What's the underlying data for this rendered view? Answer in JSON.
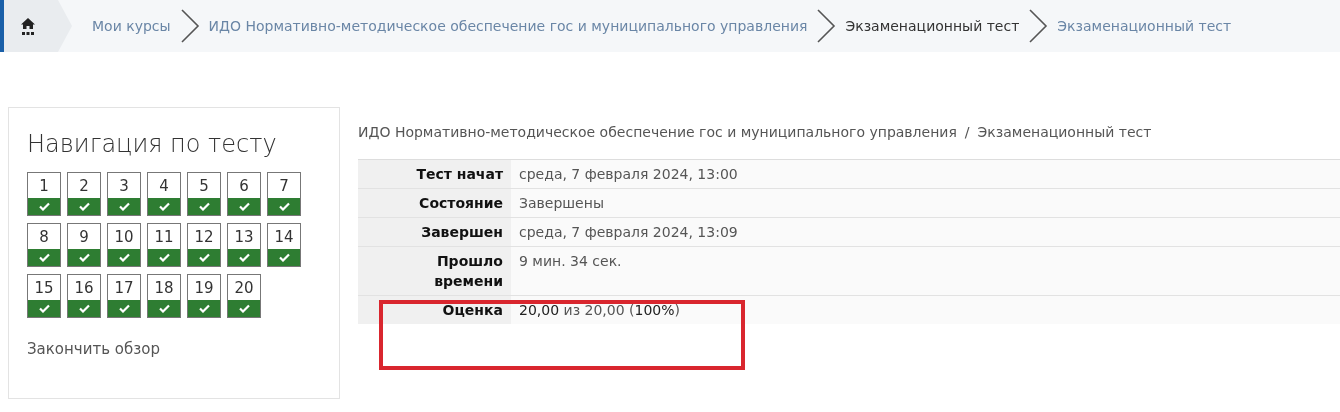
{
  "breadcrumb": [
    {
      "label": "Мои курсы",
      "kind": "link"
    },
    {
      "label": "ИДО Нормативно-методическое обеспечение гос и муниципального управления",
      "kind": "link"
    },
    {
      "label": "Экзаменационный тест",
      "kind": "current"
    },
    {
      "label": "Экзаменационный тест",
      "kind": "link"
    }
  ],
  "quiz_navigation": {
    "title": "Навигация по тесту",
    "questions": [
      {
        "number": "1",
        "answered": true
      },
      {
        "number": "2",
        "answered": true
      },
      {
        "number": "3",
        "answered": true
      },
      {
        "number": "4",
        "answered": true
      },
      {
        "number": "5",
        "answered": true
      },
      {
        "number": "6",
        "answered": true
      },
      {
        "number": "7",
        "answered": true
      },
      {
        "number": "8",
        "answered": true
      },
      {
        "number": "9",
        "answered": true
      },
      {
        "number": "10",
        "answered": true
      },
      {
        "number": "11",
        "answered": true
      },
      {
        "number": "12",
        "answered": true
      },
      {
        "number": "13",
        "answered": true
      },
      {
        "number": "14",
        "answered": true
      },
      {
        "number": "15",
        "answered": true
      },
      {
        "number": "16",
        "answered": true
      },
      {
        "number": "17",
        "answered": true
      },
      {
        "number": "18",
        "answered": true
      },
      {
        "number": "19",
        "answered": true
      },
      {
        "number": "20",
        "answered": true
      }
    ],
    "finish_link": "Закончить обзор"
  },
  "page_path": {
    "course": "ИДО Нормативно-методическое обеспечение гос и муниципального управления",
    "separator": "/",
    "quiz": "Экзаменационный тест"
  },
  "summary": [
    {
      "label": "Тест начат",
      "value": "среда, 7 февраля 2024, 13:00",
      "highlighted": false
    },
    {
      "label": "Состояние",
      "value": "Завершены",
      "highlighted": false
    },
    {
      "label": "Завершен",
      "value": "среда, 7 февраля 2024, 13:09",
      "highlighted": false
    },
    {
      "label": "Прошло времени",
      "value": "9 мин. 34 сек.",
      "highlighted": false
    },
    {
      "label": "Оценка",
      "value": "**20,00** из 20,00 (**100%**)",
      "highlighted": true
    }
  ]
}
